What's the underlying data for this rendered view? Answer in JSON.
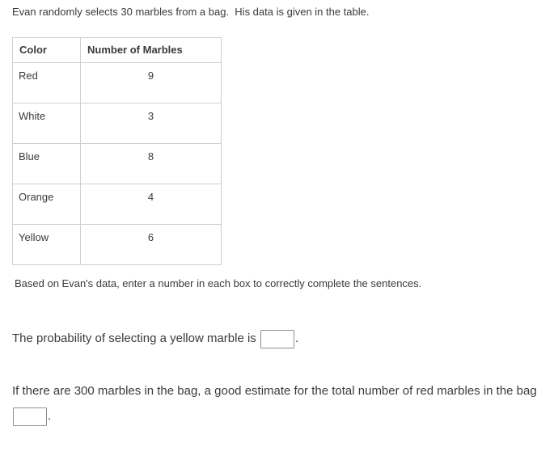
{
  "intro": {
    "text": "Evan randomly selects 30 marbles from a bag.  His data is given in the table."
  },
  "table": {
    "headers": {
      "color": "Color",
      "count": "Number of Marbles"
    },
    "rows": [
      {
        "color": "Red",
        "count": "9"
      },
      {
        "color": "White",
        "count": "3"
      },
      {
        "color": "Blue",
        "count": "8"
      },
      {
        "color": "Orange",
        "count": "4"
      },
      {
        "color": "Yellow",
        "count": "6"
      }
    ]
  },
  "instruction": {
    "text": "Based on Evan's data, enter a number in each box to correctly complete the sentences."
  },
  "questions": {
    "q1": {
      "before": "The probability of selecting a yellow marble is ",
      "after": ".",
      "value": "",
      "placeholder": ""
    },
    "q2": {
      "before": "If there are 300 marbles in the bag, a good estimate for the total number of red marbles in the bag is ",
      "after": ".",
      "value": "",
      "placeholder": ""
    }
  },
  "colors": {
    "text": "#3b3b3b",
    "table_border": "#cfcfcf",
    "input_border": "#8f8f8f",
    "background": "#ffffff"
  }
}
